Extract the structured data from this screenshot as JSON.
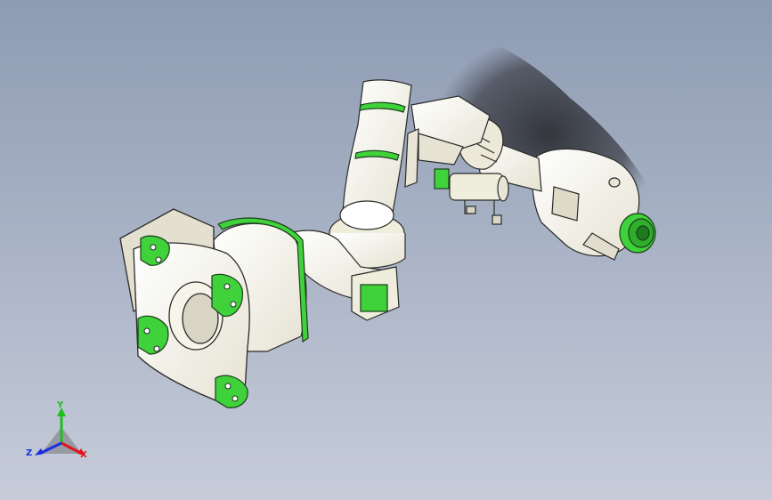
{
  "viewport": {
    "background_top": "#8e9bb3",
    "background_bottom": "#c6ccd9",
    "model_color": "#f4f2e4",
    "accent_color": "#3fd23a",
    "edge_color": "#2a2a2a"
  },
  "triad": {
    "x_label": "X",
    "y_label": "Y",
    "z_label": "Z",
    "x_color": "#e0141a",
    "y_color": "#1fbf1f",
    "z_color": "#1a2fe0"
  }
}
